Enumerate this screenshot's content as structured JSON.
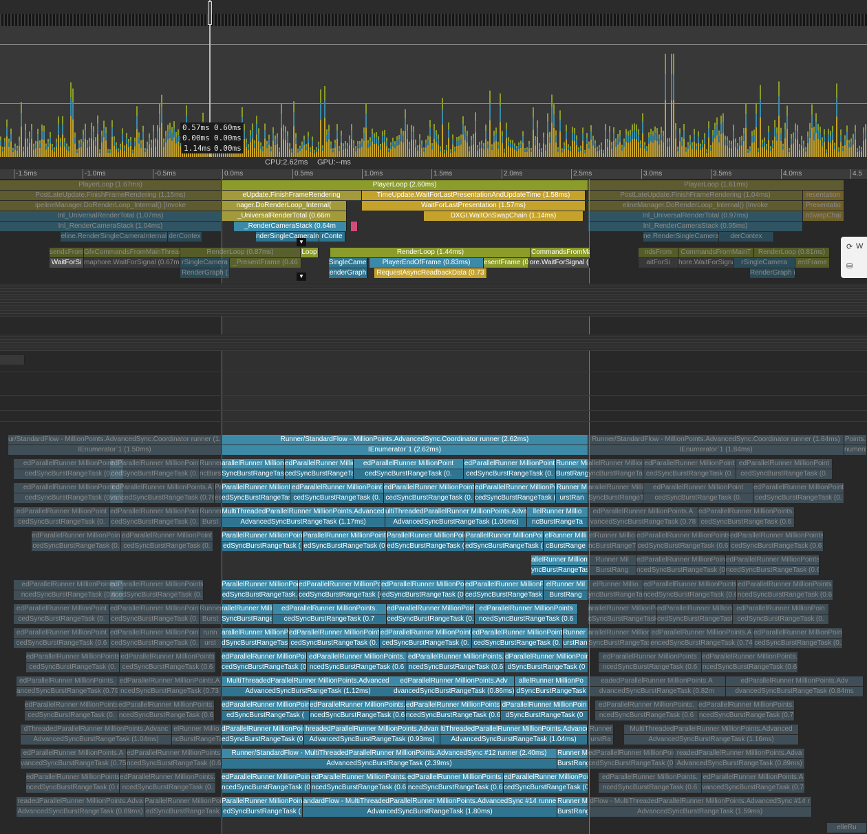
{
  "tooltip": {
    "col1": [
      "0.57ms",
      "0.00ms",
      "1.14ms"
    ],
    "col2": [
      "0.60ms",
      "0.00ms",
      "0.00ms"
    ]
  },
  "status": {
    "cpu": "CPU:2.62ms",
    "gpu": "GPU:--ms"
  },
  "ruler": [
    "-1.5ms",
    "-1.0ms",
    "-0.5ms",
    "0.0ms",
    "0.5ms",
    "1.0ms",
    "1.5ms",
    "2.0ms",
    "2.5ms",
    "3.0ms",
    "3.5ms",
    "4.0ms",
    "4.5"
  ],
  "colors": {
    "yellow": "#c5a22c",
    "olive": "#8c9c2a",
    "blue": "#3c8aa8",
    "background": "#282828"
  },
  "main_thread": {
    "player_loop": [
      "PlayerLoop (1.67ms)",
      "PlayerLoop (2.60ms)",
      "PlayerLoop (1.61ms)"
    ],
    "row2": [
      "PostLateUpdate.FinishFrameRendering (1.15ms)",
      "eUpdate.FinishFrameRendering",
      "TimeUpdate.WaitForLastPresentationAndUpdateTime (1.58ms)",
      "PostLateUpdate.FinishFrameRendering (1.04ms)",
      "resentation"
    ],
    "row3": [
      "ipelineManager.DoRenderLoop_Internal() [Invoke",
      "nager.DoRenderLoop_Internal(",
      "WaitForLastPresentation (1.57ms)",
      "elineManager.DoRenderLoop_Internal() [Invoke",
      "Presentatio"
    ],
    "row4": [
      "Inl_UniversalRenderTotal (1.07ms)",
      "_UniversalRenderTotal (0.66m",
      "DXGI.WaitOnSwapChain (1.14ms)",
      "Inl_UniversalRenderTotal (0.97ms)",
      "nSwapChai"
    ],
    "row5": [
      "Inl_RenderCameraStack (1.04ms)",
      "_RenderCameraStack (0.64m",
      "Inl_RenderCameraStack (0.95ms)"
    ],
    "row6": [
      "eline.RenderSingleCameraInternal",
      "derContex",
      "nderSingleCameraIn",
      "rConte",
      "ne.RenderSingleCameraInterna",
      "derContex"
    ]
  },
  "render_thread": {
    "row1": [
      "sendsFrom",
      "GfxCommandsFromMainThread",
      "RenderLoop (0.87ms)",
      "Loop",
      "RenderLoop (1.44ms)",
      "CommandsFromMain",
      "ndsFrom",
      "CommandsFromMainT",
      "RenderLoop (0.81ms)"
    ],
    "row2": [
      "WaitForSi",
      "maphore.WaitForSignal (0.67ms",
      "rSingleCamera",
      "_PresentFrame (0.46",
      "SingleCamer",
      "PlayerEndOfFrame (0.83ms)",
      "esentFrame (0",
      "ore.WaitForSignal (",
      "aitForSi",
      "hore.WaitForSignal (0",
      "rSingleCamera",
      "entFrame"
    ],
    "row3": [
      "RenderGraph (",
      "enderGraph",
      "RequestAsyncReadbackData (0.73",
      "RenderGraph ("
    ]
  },
  "jobs": {
    "coordinator": [
      "ur/StandardFlow - MillionPoints.AdvancedSync.Coordinator runner (1.",
      "Runner/StandardFlow - MillionPoints.AdvancedSync.Coordinator runner (2.62ms)",
      "Runner/StandardFlow - MillionPoints.AdvancedSync.Coordinator runner (1.84ms)",
      "Points."
    ],
    "enumerator": [
      "IEnumerator`1 (1.50ms)",
      "IEnumerator`1 (2.62ms)",
      "IEnumerator`1 (1.84ms)",
      "numera"
    ],
    "rows": [
      {
        "top": [
          "edParallelRunner MillionPoint",
          "edParallelRunner MillionPoint",
          "Runner",
          "arallelRunner MillionP",
          "edParallelRunner MillionPoint",
          "edParallelRunner MillionPoint",
          "edParallelRunner MillionPoint",
          "Runner Million",
          "allelRunner Million",
          "edParallelRunner MillionPoint",
          "edParallelRunner MillionPoint",
          "edParallelRunner MillionPoints."
        ],
        "bottom": [
          "cedSyncBurstRangeTask (0.",
          "cedSyncBurstRangeTask (0.",
          "ncBurst",
          "SyncBurstRangeTask",
          "cedSyncBurstRangeTask (0.",
          "cedSyncBurstRangeTask (0.",
          "cedSyncBurstRangeTask (0.",
          "BurstRang",
          "yncBurstRangeTa",
          "cedSyncBurstRangeTask (0.",
          "cedSyncBurstRangeTask (0.",
          "cedSyncBurstRangeTask (0."
        ]
      },
      {
        "top": [
          "edParallelRunner MillionPoint",
          "edParallelRunner MillionPoints.A",
          "Parallel",
          "ParallelRunner MillionPoi",
          "edParallelRunner MillionPoint",
          "edParallelRunner MillionPoint",
          "edParallelRunner MillionPoint",
          "Runner M",
          "arallelRunner MillionPo",
          "edParallelRunner MillionPoint",
          "edParallelRunner MillionPoint"
        ],
        "bottom": [
          "cedSyncBurstRangeTask (0.",
          "vancedSyncBurstRangeTask (0.76r",
          "edSync",
          "edSyncBurstRangeTask (",
          "cedSyncBurstRangeTask (0.",
          "cedSyncBurstRangeTask (0.",
          "cedSyncBurstRangeTask (0.",
          "urstRan",
          "SyncBurstRangeTas",
          "cedSyncBurstRangeTask (0.",
          "cedSyncBurstRangeTask (0."
        ]
      },
      {
        "top": [
          "edParallelRunner MillionPoint",
          "edParallelRunner MillionPoint",
          "Runner",
          "MultiThreadedParallelRunner MillionPoints.Advanced",
          "ultiThreadedParallelRunner MillionPoints.Advance",
          "llelRunner Millio",
          "edParallelRunner MillionPoints.A",
          "edParallelRunner MillionPoints."
        ],
        "bottom": [
          "cedSyncBurstRangeTask (0.",
          "cedSyncBurstRangeTask (0.",
          "Burst",
          "AdvancedSyncBurstRangeTask (1.17ms)",
          "AdvancedSyncBurstRangeTask (1.06ms)",
          "ncBurstRangeTa",
          "vancedSyncBurstRangeTask (0.78",
          "cedSyncBurstRangeTask (0.6"
        ]
      },
      {
        "top": [
          "edParallelRunner MillionPoint",
          "edParallelRunner MillionPoint",
          "ParallelRunner MillionPoint",
          "ParallelRunner MillionPoint",
          "ParallelRunner MillionPoin",
          "ParallelRunner MillionPoi",
          "elRunner Milli",
          "elRunner Millio",
          "edParallelRunner MillionPoints",
          "edParallelRunner MillionPoints"
        ],
        "bottom": [
          "cedSyncBurstRangeTask (0.",
          "cedSyncBurstRangeTask (0.",
          "edSyncBurstRangeTask (",
          "edSyncBurstRangeTask (0",
          "edSyncBurstRangeTask (",
          "edSyncBurstRangeTask (",
          "cBurstRange",
          "ncBurstRangeT",
          "cedSyncBurstRangeTask (0.6",
          "cedSyncBurstRangeTask (0.6"
        ]
      },
      {
        "top": [
          "allelRunner Million",
          "Runner Mil",
          "edParallelRunner MillionPoints.",
          "edParallelRunner MillionPoints."
        ],
        "bottom": [
          "yncBurstRangeTas",
          "BurstRang",
          "ncedSyncBurstRangeTask (0.7",
          "ncedSyncBurstRangeTask (0.6"
        ]
      },
      {
        "top": [
          "edParallelRunner MillionPoints",
          "edParallelRunner MillionPoints",
          "ParallelRunner MillionPoi",
          "edParallelRunner MillionPoint",
          "edParallelRunner MillionPoint",
          "edParallelRunner MillionPoint",
          "elRunner Mil",
          "elRunner Millio",
          "edParallelRunner MillionPoints",
          "edParallelRunner MillionPoints"
        ],
        "bottom": [
          "ncedSyncBurstRangeTask (0.6",
          "ncedSyncBurstRangeTask (0.",
          "edSyncBurstRangeTask.",
          "cedSyncBurstRangeTask (0.",
          "edSyncBurstRangeTask (0",
          "cedSyncBurstRangeTask (0.",
          "BurstRang",
          "yncBurstRangeTa",
          "ncedSyncBurstRangeTask (0.6",
          "ncedSyncBurstRangeTask (0.6"
        ]
      },
      {
        "top": [
          "edParallelRunner MillionPoint",
          "edParallelRunner MillionPoint",
          "Runner",
          "rallelRunner MillionPo",
          "edParallelRunner MillionPoints.",
          "edParallelRunner MillionPoint",
          "edParallelRunner MillionPoints",
          "arallelRunner MillionPoi",
          "edParallelRunner MillionPoint",
          "edParallelRunner MillionPoin"
        ],
        "bottom": [
          "cedSyncBurstRangeTask (0.",
          "cedSyncBurstRangeTask (0.",
          "Burst",
          "SyncBurstRangeTask",
          "cedSyncBurstRangeTask (0.7",
          "cedSyncBurstRangeTask (0.",
          "ncedSyncBurstRangeTask (0.6",
          "cSyncBurstRangeTask",
          "cedSyncBurstRangeTask (0.",
          "cedSyncBurstRangeTask (0."
        ]
      },
      {
        "top": [
          "edParallelRunner MillionPoint",
          "edParallelRunner MillionPoint",
          "runn",
          "arallelRunner MillionPc",
          "edParallelRunner MillionPoint",
          "edParallelRunner MillionPoint",
          "edParallelRunner MillionPoint",
          "Runner M",
          "arallelRunner MillionPa",
          "edParallelRunner MillionPoints.A",
          "edParallelRunner MillionPoint"
        ],
        "bottom": [
          "cedSyncBurstRangeTask (0.6",
          "cedSyncBurstRangeTask (0.",
          "urst",
          "dSyncBurstRangeTask",
          "cedSyncBurstRangeTask (0.",
          "cedSyncBurstRangeTask (0.",
          "cedSyncBurstRangeTask (0.",
          "urstRan",
          "SyncBurstRangeTas",
          "encedSyncBurstRangeTask (0.74",
          "cedSyncBurstRangeTask (0."
        ]
      },
      {
        "top": [
          "edParallelRunner MillionPoints",
          "edParallelRunner MillionPoints",
          "edParallelRunner MillionPoin",
          "edParallelRunner MillionPoints.",
          "edParallelRunner MillionPoints.",
          "dParallelRunner MillionPoin",
          "edParallelRunner MillionPoints",
          "edParallelRunner MillionPoints."
        ],
        "bottom": [
          "cedSyncBurstRangeTask (0.",
          "cedSyncBurstRangeTask (0.6",
          "cedSyncBurstRangeTask (0.",
          "ncedSyncBurstRangeTask (0.6",
          "ncedSyncBurstRangeTask (0.6",
          "dSyncBurstRangeTask (0",
          "ncedSyncBurstRangeTask (0.6",
          "ncedSyncBurstRangeTask (0.6"
        ]
      },
      {
        "top": [
          "edParallelRunner MillionPoints.",
          "edParallelRunner MillionPoints.A",
          "MultiThreadedParallelRunner MillionPoints.Advanced",
          "edParallelRunner MillionPoints.Adv",
          "allelRunner MillionPo",
          "eadedParallelRunner MillionPoints.A",
          "edParallelRunner MillionPoints.Adv"
        ],
        "bottom": [
          "ancedSyncBurstRangeTask (0.79",
          "ncedSyncBurstRangeTask (0.73",
          "AdvancedSyncBurstRangeTask (1.12ms)",
          "dvancedSyncBurstRangeTask (0.86ms)",
          "dSyncBurstRangeTask",
          "dvancedSyncBurstRangeTask (0.82m",
          "dvancedSyncBurstRangeTask (0.84ms"
        ]
      },
      {
        "top": [
          "edParallelRunner MillionPoints.",
          "edParallelRunner MillionPoints.",
          "edParallelRunner MillionPoints",
          "edParallelRunner MillionPoints.",
          "edParallelRunner MillionPoints.",
          "dParallelRunner MillionPoin",
          "edParallelRunner MillionPoints.",
          "edParallelRunner MillionPoints."
        ],
        "bottom": [
          "cedSyncBurstRangeTask (0.",
          "ncedSyncBurstRangeTask (0.6",
          "edSyncBurstRangeTask (",
          "ncedSyncBurstRangeTask (0.6",
          "ncedSyncBurstRangeTask (0.6",
          "dSyncBurstRangeTask (0",
          "ncedSyncBurstRangeTask (0.6",
          "ncedSyncBurstRangeTask (0.7"
        ]
      },
      {
        "top": [
          "dThreadedParallelRunner MillionPoints.Advanc",
          "elRunner Millio",
          "dParallelRunner MillionPoint",
          "hreadedParallelRunner MillionPoints.Advan",
          "ltiThreadedParallelRunner MillionPoints.Advance",
          "Runner",
          "MultiThreadedParallelRunner MillionPoints.Advanced"
        ],
        "bottom": [
          "AdvancedSyncBurstRangeTask (1.04ms)",
          "ncBurstRangeTa",
          "edSyncBurstRangeTask (0.",
          "AdvancedSyncBurstRangeTask (0.93ms)",
          "AdvancedSyncBurstRangeTask (1.04ms)",
          "urstRa",
          "AdvancedSyncBurstRangeTask (1.16ms)"
        ]
      },
      {
        "top": [
          "edParallelRunner MillionPoints.A",
          "edParallelRunner MillionPoints.",
          "Runner/StandardFlow - MultiThreadedParallelRunner MillionPoints.AdvancedSync #12 runner (2.40ms)",
          "Runner Mi",
          "edParallelRunner MillionPoint",
          "readedParallelRunner MillionPoints.Adva"
        ],
        "bottom": [
          "vancedSyncBurstRangeTask (0.75r",
          "ncedSyncBurstRangeTask (0.6",
          "AdvancedSyncBurstRangeTask (2.39ms)",
          "BurstRang",
          "cedSyncBurstRangeTask (0.",
          "AdvancedSyncBurstRangeTask (0.89ms)"
        ]
      },
      {
        "top": [
          "edParallelRunner MillionPoints.",
          "edParallelRunner MillionPoints.",
          "edParallelRunner MillionPoints.",
          "edParallelRunner MillionPoints.",
          "edParallelRunner MillionPoints.",
          "edParallelRunner MillionPoin",
          "edParallelRunner MillionPoints.",
          "edParallelRunner MillionPoints.A"
        ],
        "bottom": [
          "ncedSyncBurstRangeTask (0.6",
          "ncedSyncBurstRangeTask (0.",
          "ncedSyncBurstRangeTask (0.",
          "ncedSyncBurstRangeTask (0.6",
          "ncedSyncBurstRangeTask (0.6",
          "cedSyncBurstRangeTask (0",
          "ncedSyncBurstRangeTask (0.6",
          "vancedSyncBurstRangeTask (0.78"
        ]
      },
      {
        "top": [
          "readedParallelRunner MillionPoints.Adva",
          "ParallelRunner MillionPoi",
          "ParallelRunner MillionPoin",
          "andardFlow - MultiThreadedParallelRunner MillionPoints.AdvancedSync #14 runne",
          "Runner Mi",
          "dFlow - MultiThreadedParallelRunner MillionPoints.AdvancedSync #14 r"
        ],
        "bottom": [
          "AdvancedSyncBurstRangeTask (0.89ms)",
          "edSyncBurstRangeTask",
          "edSyncBurstRangeTask (",
          "AdvancedSyncBurstRangeTask (1.80ms)",
          "BurstRang",
          "AdvancedSyncBurstRangeTask (1.59ms)"
        ]
      }
    ],
    "last": "elleRu"
  },
  "side_popup": {
    "item1": "W"
  }
}
